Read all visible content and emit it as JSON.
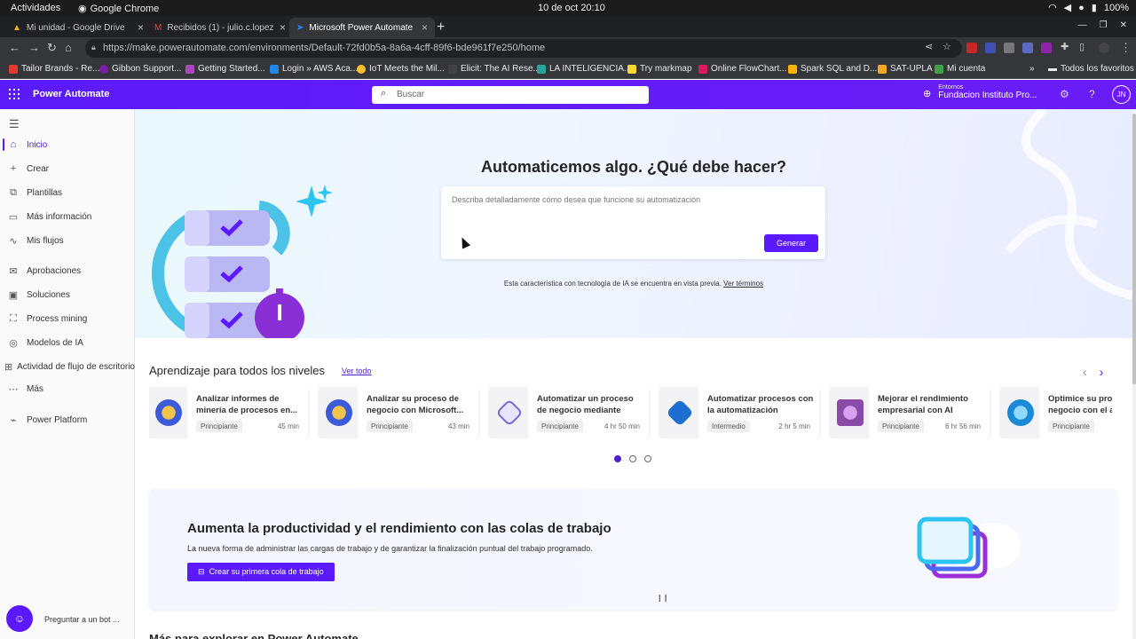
{
  "system_bar": {
    "activities": "Actividades",
    "app_name": "Google Chrome",
    "clock": "10 de oct  20:10",
    "battery": "100%"
  },
  "tabs": [
    {
      "title": "Mi unidad - Google Drive"
    },
    {
      "title": "Recibidos (1) - julio.c.lopez.n"
    },
    {
      "title": "Microsoft Power Automate",
      "active": true
    }
  ],
  "url": "https://make.powerautomate.com/environments/Default-72fd0b5a-8a6a-4cff-89f6-bde961f7e250/home",
  "bookmarks": [
    "Tailor Brands - Re...",
    "Gibbon Support...",
    "Getting Started...",
    "Login » AWS Aca...",
    "IoT Meets the Mil...",
    "Elicit: The AI Rese...",
    "LA INTELIGENCIA...",
    "Try markmap",
    "Online FlowChart...",
    "Spark SQL and D...",
    "SAT-UPLA",
    "Mi cuenta"
  ],
  "bookmarks_folder": "Todos los favoritos",
  "header": {
    "brand": "Power Automate",
    "search_placeholder": "Buscar",
    "env_label": "Entornos",
    "env_value": "Fundacion Instituto Pro...",
    "avatar_initials": "JN"
  },
  "nav": {
    "items": [
      {
        "label": "Inicio",
        "icon": "home-icon"
      },
      {
        "label": "Crear",
        "icon": "plus-icon"
      },
      {
        "label": "Plantillas",
        "icon": "templates-icon"
      },
      {
        "label": "Más información",
        "icon": "book-icon"
      },
      {
        "label": "Mis flujos",
        "icon": "flow-icon"
      },
      {
        "label": "Aprobaciones",
        "icon": "approvals-icon"
      },
      {
        "label": "Soluciones",
        "icon": "solutions-icon"
      },
      {
        "label": "Process mining",
        "icon": "process-mining-icon"
      },
      {
        "label": "Modelos de IA",
        "icon": "ai-models-icon"
      },
      {
        "label": "Actividad de flujo de escritorio",
        "icon": "desktop-flow-icon"
      },
      {
        "label": "Más",
        "icon": "more-icon"
      },
      {
        "label": "Power Platform",
        "icon": "power-platform-icon"
      }
    ],
    "bot_label": "Preguntar a un bot ..."
  },
  "hero": {
    "title": "Automaticemos algo. ¿Qué debe hacer?",
    "placeholder": "Describa detalladamente cómo desea que funcione su automatización",
    "generate": "Generar",
    "disclaimer": "Esta característica con tecnología de IA se encuentra en vista previa.",
    "terms": "Ver términos"
  },
  "learning": {
    "title": "Aprendizaje para todos los niveles",
    "see_all": "Ver todo",
    "cards": [
      {
        "title": "Analizar informes de minería de procesos en...",
        "level": "Principiante",
        "duration": "45 min",
        "color": "#3c5bd9"
      },
      {
        "title": "Analizar su proceso de negocio con Microsoft...",
        "level": "Principiante",
        "duration": "43 min",
        "color": "#3c5bd9"
      },
      {
        "title": "Automatizar un proceso de negocio mediante Power...",
        "level": "Principiante",
        "duration": "4 hr 50 min",
        "color": "#7a6ad8"
      },
      {
        "title": "Automatizar procesos con la automatización robótic...",
        "level": "Intermedio",
        "duration": "2 hr 5 min",
        "color": "#1c6fd1"
      },
      {
        "title": "Mejorar el rendimiento empresarial con AI Builder",
        "level": "Principiante",
        "duration": "6 hr 56 min",
        "color": "#8a4aa8"
      },
      {
        "title": "Optimice su proceso de negocio con el as...",
        "level": "Principiante",
        "duration": "",
        "color": "#1a8ad6"
      }
    ],
    "page_count": 3,
    "current_page": 1
  },
  "banner": {
    "title": "Aumenta la productividad y el rendimiento con las colas de trabajo",
    "text": "La nueva forma de administrar las cargas de trabajo y de garantizar la finalización puntual del trabajo programado.",
    "cta": "Crear su primera cola de trabajo"
  },
  "next_section_title": "Más para explorar en Power Automate",
  "colors": {
    "brand": "#5b19ff",
    "accent": "#4e1fd1"
  }
}
